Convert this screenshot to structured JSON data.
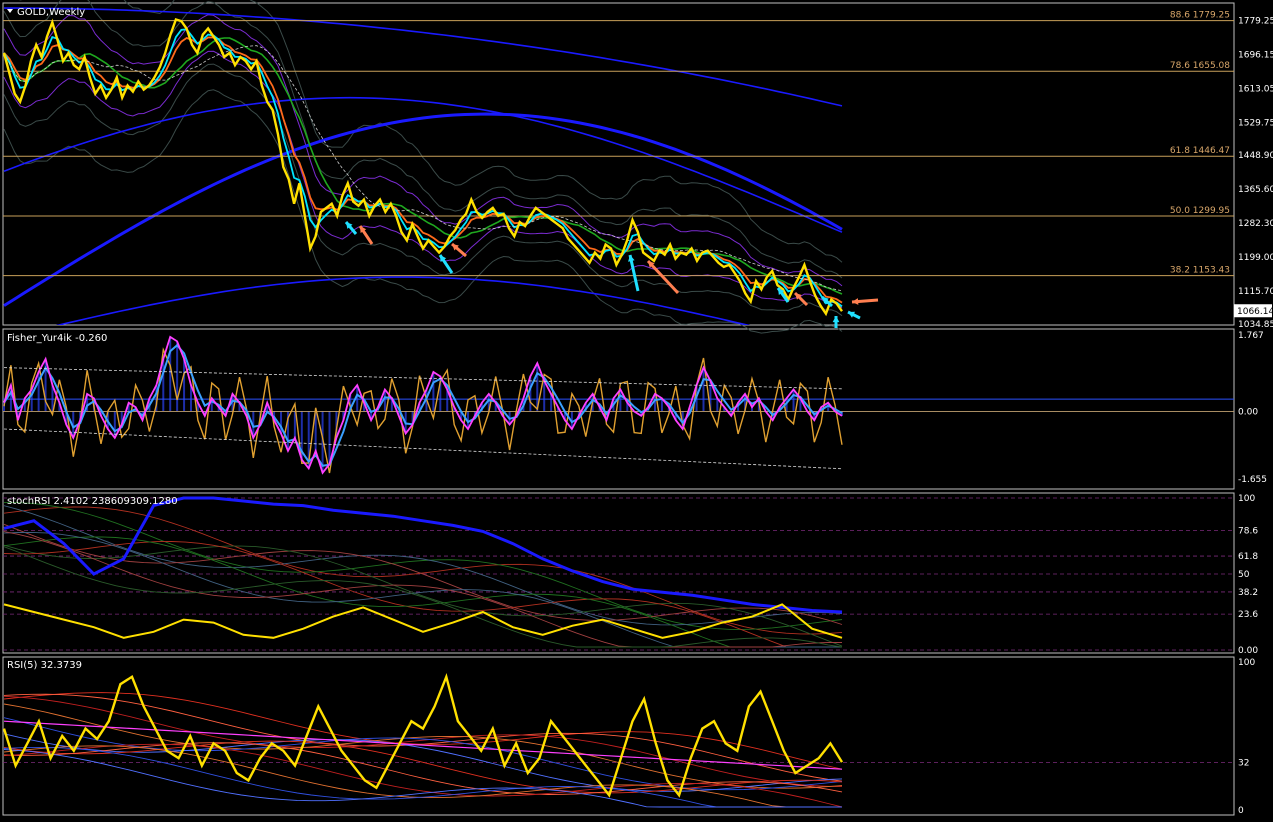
{
  "colors": {
    "background": "#000000",
    "border": "#c0c0c0",
    "axis_text": "#ffffff",
    "fib_line": "#c8a05a",
    "fib_text": "#d9a76a",
    "price": "#ffe000",
    "ema_fast": "#00e5ff",
    "ema_slow": "#ff6a1a",
    "sma": "#1fa81f",
    "long_ma": "#1a1aff",
    "band_dim": "#3a4a48",
    "band_purple": "#7a2bd0",
    "fisher_main": "#ff40ff",
    "fisher_signal": "#3aa0ff",
    "fisher_osc": "#e0a030",
    "fisher_hist": "#1e2ea8",
    "arrow_up": "#20e0ff",
    "arrow_down": "#ff7f50",
    "current_box": "#ffffff"
  },
  "header": {
    "menu_icon": "triangle-down-icon",
    "symbol_label": "GOLD,Weekly"
  },
  "panels": {
    "price": {
      "fib_levels": [
        {
          "label": "88.6 1779.25",
          "value": 1779.25
        },
        {
          "label": "78.6 1655.08",
          "value": 1655.08
        },
        {
          "label": "61.8 1446.47",
          "value": 1446.47
        },
        {
          "label": "50.0 1299.95",
          "value": 1299.95
        },
        {
          "label": "38.2 1153.43",
          "value": 1153.43
        }
      ],
      "current_price": "1066.14"
    },
    "fisher": {
      "label": "Fisher_Yur4ik -0.260",
      "ticks": [
        "1.767",
        "0.00",
        "-1.655"
      ]
    },
    "stochrsi": {
      "label": "stochRSI 2.4102 238609309.1280",
      "ticks": [
        "100",
        "78.6",
        "61.8",
        "50",
        "38.2",
        "23.6",
        "0.00"
      ]
    },
    "rsi": {
      "label": "RSI(5) 32.3739",
      "ticks": [
        "100",
        "32",
        "0"
      ]
    }
  },
  "chart_data": [
    {
      "type": "line",
      "panel": "price",
      "symbol": "GOLD",
      "timeframe": "Weekly",
      "ylim": [
        1034.85,
        1820
      ],
      "yticks": [
        1779.25,
        1696.15,
        1613.05,
        1529.75,
        1448.9,
        1365.6,
        1282.3,
        1199.0,
        1115.7,
        1034.85
      ],
      "ytick_labels": [
        "1779.25",
        "1696.15",
        "1613.05",
        "1529.75",
        "1448.90",
        "1365.60",
        "1282.30",
        "1199.00",
        "1115.70",
        "1034.85"
      ],
      "current_price": 1066.14,
      "series": [
        {
          "values": [
            1700,
            1650,
            1600,
            1580,
            1620,
            1680,
            1720,
            1690,
            1740,
            1775,
            1730,
            1680,
            1700,
            1670,
            1660,
            1690,
            1640,
            1600,
            1620,
            1590,
            1610,
            1640,
            1590,
            1620,
            1605,
            1630,
            1610,
            1620,
            1640,
            1665,
            1700,
            1745,
            1782,
            1778,
            1760,
            1720,
            1700,
            1745,
            1760,
            1740,
            1720,
            1690,
            1700,
            1670,
            1690,
            1680,
            1660,
            1680,
            1620,
            1580,
            1560,
            1500,
            1420,
            1390,
            1330,
            1380,
            1300,
            1220,
            1250,
            1310,
            1320,
            1330,
            1300,
            1350,
            1380,
            1335,
            1325,
            1340,
            1300,
            1325,
            1340,
            1310,
            1330,
            1300,
            1260,
            1240,
            1280,
            1250,
            1220,
            1240,
            1225,
            1210,
            1225,
            1250,
            1265,
            1290,
            1305,
            1340,
            1310,
            1295,
            1310,
            1320,
            1300,
            1305,
            1270,
            1250,
            1285,
            1275,
            1300,
            1320,
            1310,
            1300,
            1290,
            1280,
            1270,
            1245,
            1230,
            1215,
            1200,
            1185,
            1210,
            1195,
            1230,
            1220,
            1180,
            1205,
            1240,
            1290,
            1260,
            1210,
            1200,
            1190,
            1215,
            1205,
            1230,
            1195,
            1210,
            1205,
            1220,
            1190,
            1210,
            1215,
            1200,
            1185,
            1175,
            1180,
            1160,
            1140,
            1110,
            1090,
            1140,
            1120,
            1150,
            1165,
            1130,
            1120,
            1095,
            1125,
            1150,
            1180,
            1140,
            1105,
            1080,
            1060,
            1095,
            1085,
            1066.14
          ]
        }
      ]
    },
    {
      "type": "line",
      "panel": "fisher",
      "ylim": [
        -1.655,
        1.767
      ],
      "series": [
        {
          "values": [
            0.2,
            0.6,
            -0.2,
            0.3,
            0.5,
            0.9,
            1.2,
            0.6,
            0.2,
            -0.3,
            -0.6,
            -0.2,
            0.4,
            0.3,
            -0.1,
            -0.4,
            -0.6,
            -0.3,
            0.2,
            0.1,
            -0.2,
            0.3,
            0.6,
            1.2,
            1.7,
            1.6,
            1.2,
            0.6,
            0.2,
            -0.1,
            0.3,
            0.1,
            -0.1,
            0.4,
            0.2,
            -0.1,
            -0.6,
            -0.3,
            0.2,
            -0.2,
            -0.5,
            -0.9,
            -0.6,
            -1.1,
            -1.3,
            -0.9,
            -1.4,
            -1.2,
            -0.6,
            -0.2,
            0.4,
            0.6,
            0.2,
            -0.2,
            0.1,
            0.5,
            0.3,
            -0.1,
            -0.5,
            -0.3,
            0.2,
            0.5,
            0.9,
            0.8,
            0.5,
            0.1,
            -0.2,
            -0.4,
            -0.1,
            0.2,
            0.4,
            0.2,
            -0.1,
            -0.3,
            -0.1,
            0.3,
            0.8,
            1.1,
            0.7,
            0.4,
            0.1,
            -0.2,
            -0.4,
            -0.1,
            0.2,
            0.4,
            0.1,
            -0.2,
            0.3,
            0.5,
            0.2,
            0.0,
            -0.1,
            0.1,
            0.4,
            0.3,
            0.1,
            -0.2,
            -0.4,
            0.1,
            0.6,
            1.0,
            0.7,
            0.3,
            0.1,
            -0.1,
            0.2,
            0.4,
            0.1,
            0.3,
            0.0,
            -0.2,
            0.1,
            0.3,
            0.5,
            0.3,
            0.0,
            -0.2,
            0.1,
            0.2,
            0.0,
            -0.1
          ]
        }
      ]
    },
    {
      "type": "line",
      "panel": "stochrsi",
      "ylim": [
        0,
        100
      ],
      "series": [
        {
          "values": [
            80,
            85,
            70,
            50,
            60,
            95,
            100,
            100,
            98,
            96,
            95,
            92,
            90,
            88,
            85,
            82,
            78,
            70,
            60,
            52,
            45,
            40,
            38,
            36,
            33,
            30,
            28,
            26,
            25
          ]
        },
        {
          "values": [
            30,
            25,
            20,
            15,
            8,
            12,
            20,
            18,
            10,
            8,
            14,
            22,
            28,
            20,
            12,
            18,
            25,
            15,
            10,
            16,
            20,
            14,
            8,
            12,
            18,
            22,
            30,
            14,
            8
          ]
        }
      ]
    },
    {
      "type": "line",
      "panel": "rsi",
      "ylim": [
        0,
        100
      ],
      "series": [
        {
          "values": [
            55,
            30,
            45,
            60,
            35,
            50,
            40,
            55,
            48,
            60,
            85,
            90,
            70,
            55,
            40,
            35,
            50,
            30,
            45,
            40,
            25,
            20,
            35,
            45,
            40,
            30,
            50,
            70,
            55,
            40,
            30,
            20,
            15,
            30,
            45,
            60,
            55,
            70,
            90,
            60,
            50,
            40,
            55,
            30,
            45,
            25,
            35,
            60,
            50,
            40,
            30,
            20,
            10,
            35,
            60,
            75,
            45,
            20,
            10,
            35,
            55,
            60,
            45,
            40,
            70,
            80,
            60,
            40,
            25,
            30,
            35,
            45,
            32.3739
          ]
        }
      ]
    }
  ]
}
